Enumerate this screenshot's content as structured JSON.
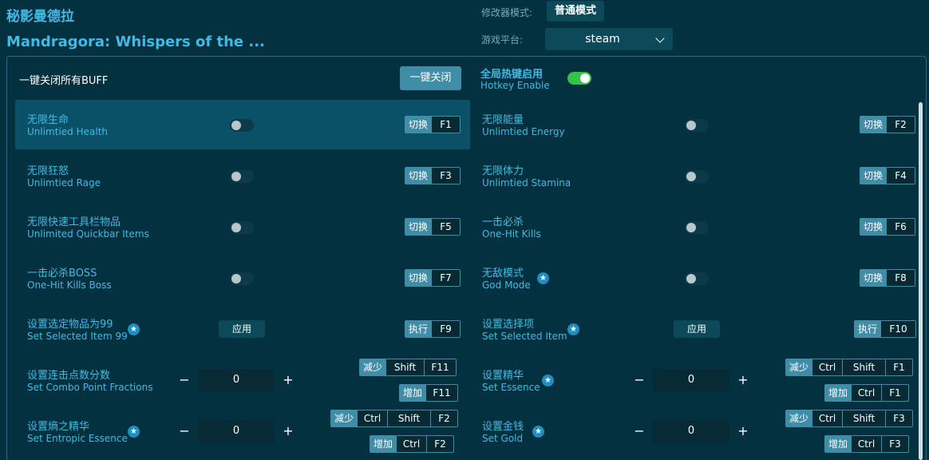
{
  "header": {
    "title_cn": "秘影曼德拉",
    "title_en": "Mandragora: Whispers of the ...",
    "mode_label": "修改器模式:",
    "mode_value": "普通模式",
    "platform_label": "游戏平台:",
    "platform_value": "steam"
  },
  "top": {
    "close_all_label": "一键关闭所有BUFF",
    "close_all_button": "一键关闭",
    "hotkey_cn": "全局热键启用",
    "hotkey_en": "Hotkey Enable"
  },
  "cheats": {
    "c1": {
      "cn": "无限生命",
      "en": "Unlimtied Health",
      "act": "切换",
      "key": "F1"
    },
    "c2": {
      "cn": "无限能量",
      "en": "Unlimtied Energy",
      "act": "切换",
      "key": "F2"
    },
    "c3": {
      "cn": "无限狂怒",
      "en": "Unlimtied Rage",
      "act": "切换",
      "key": "F3"
    },
    "c4": {
      "cn": "无限体力",
      "en": "Unlimtied Stamina",
      "act": "切换",
      "key": "F4"
    },
    "c5": {
      "cn": "无限快速工具栏物品",
      "en": "Unlimited Quickbar Items",
      "act": "切换",
      "key": "F5"
    },
    "c6": {
      "cn": "一击必杀",
      "en": "One-Hit Kills",
      "act": "切换",
      "key": "F6"
    },
    "c7": {
      "cn": "一击必杀BOSS",
      "en": "One-Hit Kills Boss",
      "act": "切换",
      "key": "F7"
    },
    "c8": {
      "cn": "无敌模式",
      "en": "God Mode",
      "act": "切换",
      "key": "F8"
    },
    "c9": {
      "cn": "设置选定物品为99",
      "en": "Set Selected Item 99",
      "apply": "应用",
      "act": "执行",
      "key": "F9"
    },
    "c10": {
      "cn": "设置选择项",
      "en": "Set Selected Item",
      "apply": "应用",
      "act": "执行",
      "key": "F10"
    },
    "c11": {
      "cn": "设置连击点数分数",
      "en": "Set Combo Point Fractions",
      "value": "0",
      "dec": "减少",
      "inc": "增加",
      "k1": "Shift",
      "k2": "F11"
    },
    "c12": {
      "cn": "设置精华",
      "en": "Set Essence",
      "value": "0",
      "dec": "减少",
      "inc": "增加",
      "k1": "Ctrl",
      "k2": "Shift",
      "k3": "F1"
    },
    "c13": {
      "cn": "设置熵之精华",
      "en": "Set Entropic Essence",
      "value": "0",
      "dec": "减少",
      "inc": "增加",
      "k1": "Ctrl",
      "k2": "Shift",
      "k3": "F2"
    },
    "c14": {
      "cn": "设置金钱",
      "en": "Set Gold",
      "value": "0",
      "dec": "减少",
      "inc": "增加",
      "k1": "Ctrl",
      "k2": "Shift",
      "k3": "F3"
    }
  },
  "icons": {
    "star": "star-icon",
    "minus": "minus-icon",
    "plus": "plus-icon",
    "chevron": "chevron-down-icon"
  },
  "colors": {
    "accent": "#43b9e3",
    "toggle_on": "#35c24a",
    "background": "#03313f"
  }
}
